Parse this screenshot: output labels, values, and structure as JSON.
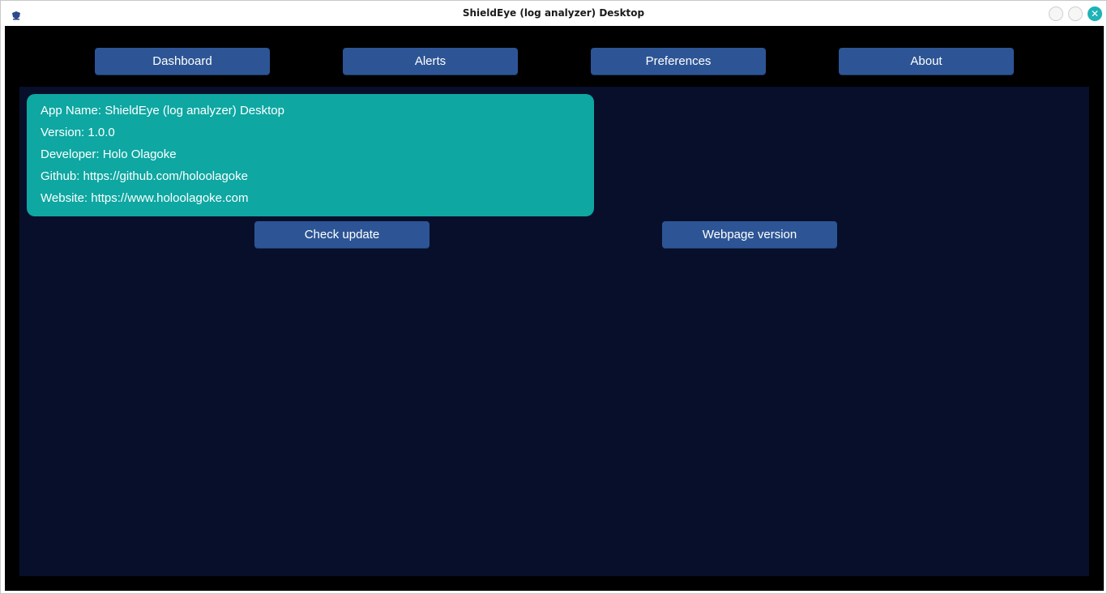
{
  "window": {
    "title": "ShieldEye (log analyzer) Desktop",
    "close_glyph": "✕"
  },
  "nav": {
    "items": [
      {
        "label": "Dashboard"
      },
      {
        "label": "Alerts"
      },
      {
        "label": "Preferences"
      },
      {
        "label": "About"
      }
    ]
  },
  "about": {
    "lines": [
      "App Name: ShieldEye (log analyzer) Desktop",
      "Version: 1.0.0",
      "Developer: Holo Olagoke",
      "Github: https://github.com/holoolagoke",
      "Website: https://www.holoolagoke.com"
    ],
    "check_update_label": "Check update",
    "webpage_version_label": "Webpage version"
  },
  "colors": {
    "button": "#2d5595",
    "card": "#0ea7a2",
    "panel": "#070f2a",
    "background": "#000000",
    "close_button": "#1fb3b6"
  },
  "icons": {
    "app": "shield-icon",
    "minimize": "minimize-icon",
    "maximize": "maximize-icon",
    "close": "close-icon"
  }
}
